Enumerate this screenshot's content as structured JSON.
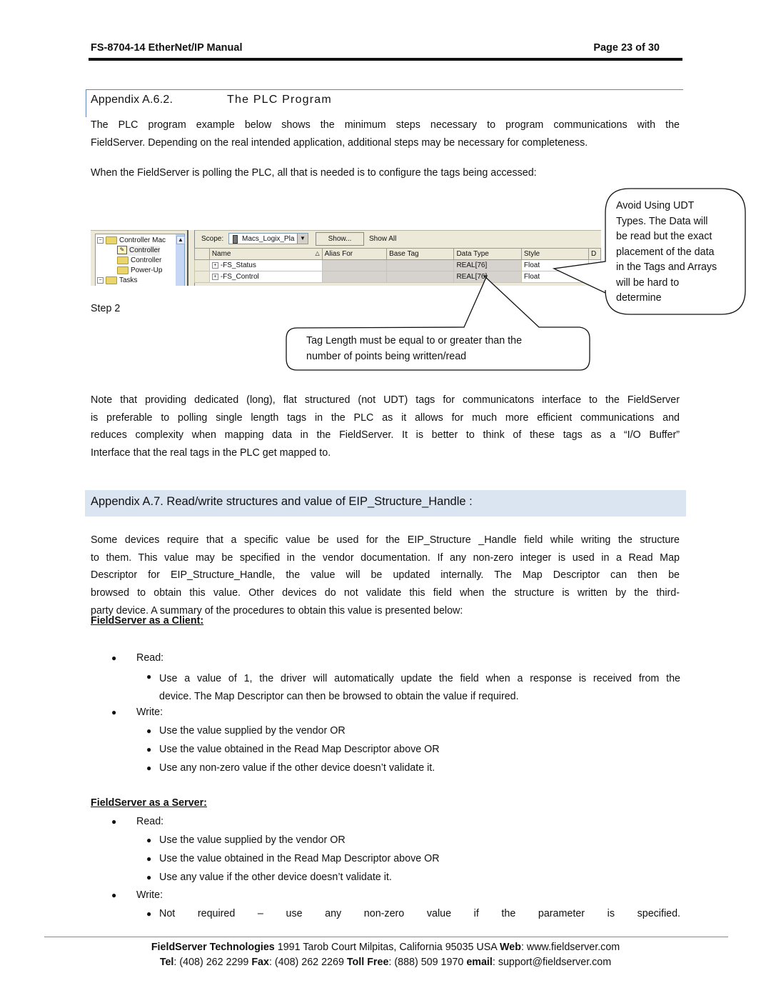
{
  "header": {
    "doc_title": "FS-8704-14 EtherNet/IP Manual",
    "page_label": "Page 23 of 30"
  },
  "section_a62": {
    "number": "Appendix A.6.2.",
    "title": "The PLC Program",
    "para1_line1": "The PLC program example below shows the minimum steps necessary to program communications with the",
    "para1_line2": "FieldServer. Depending on the real intended application, additional steps may be necessary for completeness.",
    "para2": "When the FieldServer is polling the PLC, all that is needed is to configure the tags being accessed:"
  },
  "screenshot": {
    "tree_items": [
      "Controller Mac",
      "Controller",
      "Controller",
      "Power-Up",
      "Tasks"
    ],
    "scope_label": "Scope:",
    "scope_value": "Macs_Logix_Pla",
    "show_button": "Show...",
    "show_all": "Show All",
    "columns": [
      "Name",
      "Alias For",
      "Base Tag",
      "Data Type",
      "Style",
      "D"
    ],
    "rows": [
      {
        "name": "FS_Status",
        "alias": "",
        "base": "",
        "type": "REAL[76]",
        "style": "Float"
      },
      {
        "name": "FS_Control",
        "alias": "",
        "base": "",
        "type": "REAL[76]",
        "style": "Float"
      }
    ]
  },
  "step_label": "Step 2",
  "callout_udt": [
    "Avoid Using UDT",
    "Types.  The Data will",
    "be read but the exact",
    "placement of the data",
    "in the Tags and Arrays",
    "will be hard to",
    "determine"
  ],
  "callout_length": [
    "Tag Length must be equal to or greater than the",
    "number of points being written/read"
  ],
  "note_paragraph": [
    "Note that providing dedicated (long), flat structured (not UDT) tags for communicatons interface to the FieldServer",
    "is preferable to polling single length tags in the PLC as it allows for much more efficient communications and",
    "reduces complexity when mapping data in the FieldServer. It is better to think of these tags as a “I/O Buffer”",
    "Interface that the real tags in the PLC get mapped to."
  ],
  "section_a7": {
    "title": "Appendix A.7. Read/write structures and value of EIP_Structure_Handle :",
    "paragraph": [
      "Some devices require that a specific value be used for the EIP_Structure _Handle field while writing the structure",
      "to them.  This value may be specified in the vendor documentation.  If any non-zero integer is used in a Read Map",
      "Descriptor for EIP_Structure_Handle, the value will be updated internally.  The Map Descriptor can then be",
      "browsed to obtain this value.   Other devices do not validate this field when the structure is written by the third-",
      "party device.  A summary of the procedures to obtain this value is presented below:"
    ]
  },
  "client": {
    "heading": "FieldServer as a Client:",
    "read_label": "Read:",
    "read_items": [
      [
        "Use a value of 1, the driver will automatically update the field when a response is received from the",
        "device.  The Map Descriptor can then be browsed to obtain the value if required."
      ]
    ],
    "write_label": "Write:",
    "write_items": [
      "Use the value supplied by the vendor OR",
      "Use the value obtained in the Read Map Descriptor above OR",
      "Use any non-zero value if the other device doesn’t validate it."
    ]
  },
  "server": {
    "heading": "FieldServer as a Server:",
    "read_label": "Read:",
    "read_items": [
      "Use the value supplied by the vendor OR",
      "Use the value obtained in the Read Map Descriptor above OR",
      "Use any value if the other device doesn’t validate it."
    ],
    "write_label": "Write:",
    "write_items": [
      "Not required – use any non-zero value if the parameter is specified."
    ]
  },
  "footer": {
    "company": "FieldServer Technologies",
    "address": " 1991 Tarob Court Milpitas, California 95035 USA   ",
    "web_label": "Web",
    "web": ": www.fieldserver.com",
    "tel_label": "Tel",
    "tel": ": (408) 262 2299   ",
    "fax_label": "Fax",
    "fax": ": (408) 262 2269   ",
    "tollfree_label": "Toll Free",
    "tollfree": ": (888) 509 1970   ",
    "email_label": "email",
    "email": ": support@fieldserver.com"
  },
  "colors": {
    "section_rule": "#5b86bf",
    "appendix_band": "#dbe4f1"
  }
}
